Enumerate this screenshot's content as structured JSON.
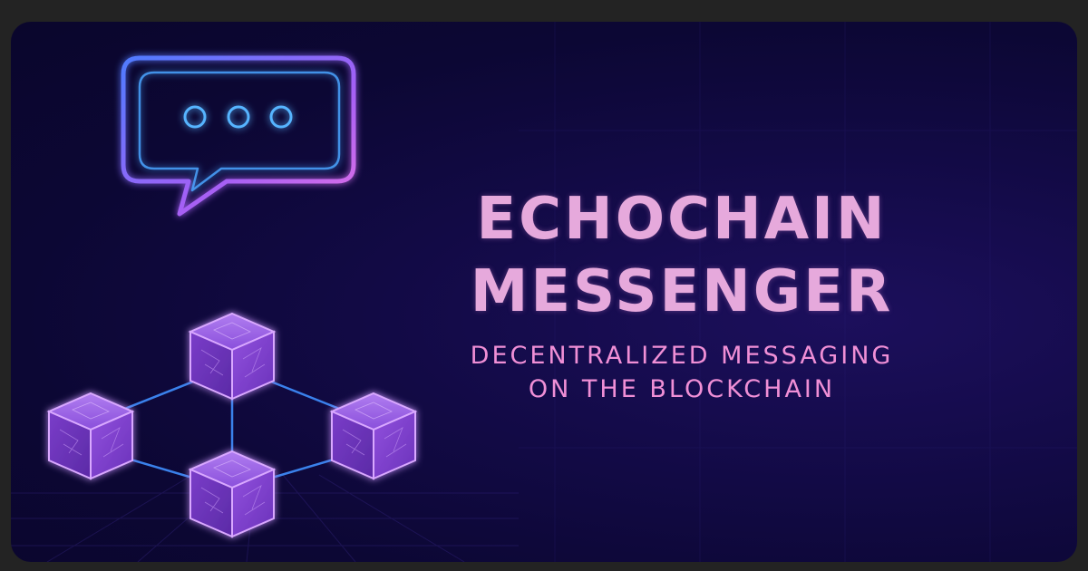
{
  "banner": {
    "title_line1": "ECHOCHAIN",
    "title_line2": "MESSENGER",
    "subtitle_line1": "DECENTRALIZED MESSAGING",
    "subtitle_line2": "ON THE BLOCKCHAIN"
  },
  "icons": {
    "chat": "chat-bubble-icon",
    "blocks": "blockchain-network-icon"
  },
  "colors": {
    "background": "#0c0734",
    "title": "#e6a9dc",
    "subtitle": "#f08fd6",
    "bubble_outer": "#b45cf0",
    "bubble_inner": "#4aa3ff",
    "cube": "#7b3fd0",
    "connector": "#3f8fff"
  }
}
